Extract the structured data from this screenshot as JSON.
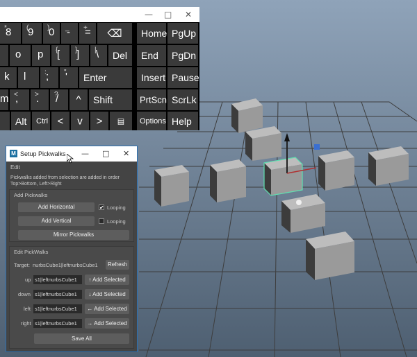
{
  "keyboard": {
    "window_buttons": [
      "—",
      "□",
      "✕"
    ],
    "row1": [
      {
        "sup": "*",
        "main": "8"
      },
      {
        "sup": "(",
        "main": "9"
      },
      {
        "sup": ")",
        "main": "0"
      },
      {
        "sup": "_",
        "main": "-"
      },
      {
        "sup": "+",
        "main": "="
      },
      {
        "sup": "",
        "main": "⌫"
      }
    ],
    "row2": [
      {
        "sup": "",
        "main": "o"
      },
      {
        "sup": "",
        "main": "p"
      },
      {
        "sup": "{",
        "main": "["
      },
      {
        "sup": "}",
        "main": "]"
      },
      {
        "sup": "|",
        "main": "\\"
      },
      {
        "sup": "",
        "main": "Del"
      }
    ],
    "row3": [
      {
        "sup": "",
        "main": "k"
      },
      {
        "sup": "",
        "main": "l"
      },
      {
        "sup": ":",
        "main": ";"
      },
      {
        "sup": "\"",
        "main": "'"
      },
      {
        "sup": "",
        "main": "Enter"
      }
    ],
    "row4": [
      {
        "sup": "",
        "main": "m"
      },
      {
        "sup": "<",
        "main": ","
      },
      {
        "sup": ">",
        "main": "."
      },
      {
        "sup": "?",
        "main": "/"
      },
      {
        "sup": "",
        "main": "^"
      },
      {
        "sup": "",
        "main": "Shift"
      }
    ],
    "row5": [
      {
        "sup": "",
        "main": "Alt"
      },
      {
        "sup": "",
        "main": "Ctrl"
      },
      {
        "sup": "",
        "main": "<"
      },
      {
        "sup": "",
        "main": "v"
      },
      {
        "sup": "",
        "main": ">"
      },
      {
        "sup": "",
        "main": "▤"
      }
    ],
    "right_keys": [
      [
        "Home",
        "PgUp"
      ],
      [
        "End",
        "PgDn"
      ],
      [
        "Insert",
        "Pause"
      ],
      [
        "PrtScn",
        "ScrLk"
      ],
      [
        "Options",
        "Help"
      ]
    ]
  },
  "dialog": {
    "title": "Setup Pickwalks",
    "logo": "M",
    "window_buttons": [
      "—",
      "□",
      "✕"
    ],
    "menu": "Edit",
    "help_line1": "Pickwalks added from selection are added in order",
    "help_line2": "Top>Bottom, Left>Right",
    "add_section": {
      "header": "Add Pickwalks",
      "add_horizontal": "Add Horizontal",
      "add_vertical": "Add Vertical",
      "looping1_label": "Looping",
      "looping1_checked": true,
      "looping2_label": "Looping",
      "looping2_checked": false,
      "mirror": "Mirror Pickwalks"
    },
    "edit_section": {
      "header": "Edit PickWalks",
      "target_label": "Target:",
      "target_value": "nurbsCube1|leftnurbsCube1",
      "refresh": "Refresh",
      "rows": [
        {
          "label": "up",
          "value": "s1|leftnurbsCube1",
          "button": "Add Selected",
          "arrow": "↑"
        },
        {
          "label": "down",
          "value": "s1|leftnurbsCube1",
          "button": "Add Selected",
          "arrow": "↓"
        },
        {
          "label": "left",
          "value": "s1|leftnurbsCube1",
          "button": "Add Selected",
          "arrow": "←"
        },
        {
          "label": "right",
          "value": "s1|leftnurbsCube1",
          "button": "Add Selected",
          "arrow": "→"
        }
      ],
      "save_all": "Save All"
    }
  },
  "colors": {
    "viewport_top": "#8fa3b9",
    "viewport_bottom": "#4e5f71",
    "cube_light": "#aaaaaa",
    "cube_dark": "#4a4a4a",
    "selection": "#5fe0b0"
  }
}
